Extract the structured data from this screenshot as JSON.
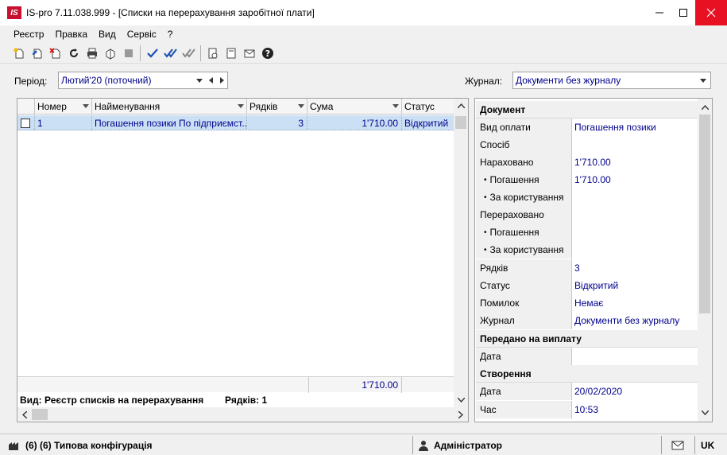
{
  "window": {
    "logo_text": "IS",
    "title": "IS-pro 7.11.038.999 - [Списки на перерахування заробітної плати]"
  },
  "menu": [
    "Реєстр",
    "Правка",
    "Вид",
    "Сервіс",
    "?"
  ],
  "toolbar_icons": [
    "new-icon",
    "edit-icon",
    "delete-icon",
    "refresh-icon",
    "print-icon",
    "export-icon",
    "stop-icon",
    "check-icon",
    "double-check-icon",
    "check-all-icon",
    "report-icon",
    "document-icon",
    "email-icon",
    "help-icon"
  ],
  "filters": {
    "period_label": "Період:",
    "period_value": "Лютий'20 (поточний)",
    "journal_label": "Журнал:",
    "journal_value": "Документи без журналу"
  },
  "grid": {
    "columns": [
      "Номер",
      "Найменування",
      "Рядків",
      "Сума",
      "Статус"
    ],
    "rows": [
      {
        "number": "1",
        "name": "Погашення позики По підприємст...",
        "rows": "3",
        "sum": "1'710.00",
        "status": "Відкритий"
      }
    ],
    "total_sum": "1'710.00",
    "view_text": "Вид: Реєстр списків на перерахування",
    "rows_count_text": "Рядків: 1"
  },
  "properties": {
    "group_document": "Документ",
    "fields": [
      {
        "label": "Вид оплати",
        "value": "Погашення позики",
        "sub": false
      },
      {
        "label": "Спосіб",
        "value": "",
        "sub": false
      },
      {
        "label": "Нараховано",
        "value": "1'710.00",
        "sub": false
      },
      {
        "label": "Погашення",
        "value": "1'710.00",
        "sub": true
      },
      {
        "label": "За користування",
        "value": "",
        "sub": true
      },
      {
        "label": "Перераховано",
        "value": "",
        "sub": false
      },
      {
        "label": "Погашення",
        "value": "",
        "sub": true
      },
      {
        "label": "За користування",
        "value": "",
        "sub": true
      },
      {
        "label": "Рядків",
        "value": "3",
        "sub": false
      },
      {
        "label": "Статус",
        "value": "Відкритий",
        "sub": false
      },
      {
        "label": "Помилок",
        "value": "Немає",
        "sub": false
      },
      {
        "label": "Журнал",
        "value": "Документи без журналу",
        "sub": false
      }
    ],
    "group_paid": "Передано на виплату",
    "paid_date_label": "Дата",
    "paid_date_value": "",
    "group_created": "Створення",
    "created_date_label": "Дата",
    "created_date_value": "20/02/2020",
    "created_time_label": "Час",
    "created_time_value": "10:53"
  },
  "statusbar": {
    "config": "(6) (6) Типова конфігурація",
    "user": "Адміністратор",
    "lang": "UK"
  }
}
